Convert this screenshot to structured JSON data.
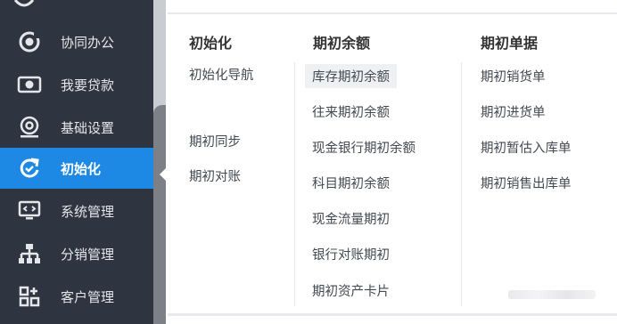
{
  "sidebar": {
    "items": [
      {
        "label": "协同办公",
        "icon": "collaboration-icon",
        "active": false
      },
      {
        "label": "我要贷款",
        "icon": "loan-icon",
        "active": false
      },
      {
        "label": "基础设置",
        "icon": "settings-icon",
        "active": false
      },
      {
        "label": "初始化",
        "icon": "initialize-icon",
        "active": true
      },
      {
        "label": "系统管理",
        "icon": "system-monitor-icon",
        "active": false
      },
      {
        "label": "分销管理",
        "icon": "distribution-icon",
        "active": false
      },
      {
        "label": "客户管理",
        "icon": "customer-icon",
        "active": false
      }
    ]
  },
  "menu": {
    "columns": [
      {
        "title": "初始化",
        "links": [
          "初始化导航",
          "期初同步",
          "期初对账"
        ]
      },
      {
        "title": "期初余额",
        "links": [
          "库存期初余额",
          "往来期初余额",
          "现金银行期初余额",
          "科目期初余额",
          "现金流量期初",
          "银行对账期初",
          "期初资产卡片"
        ]
      },
      {
        "title": "期初单据",
        "links": [
          "期初销货单",
          "期初进货单",
          "期初暂估入库单",
          "期初销售出库单"
        ]
      }
    ]
  },
  "colors": {
    "sidebar_bg": "#2e3440",
    "active_bg": "#1e88e5",
    "text": "#444a52"
  }
}
